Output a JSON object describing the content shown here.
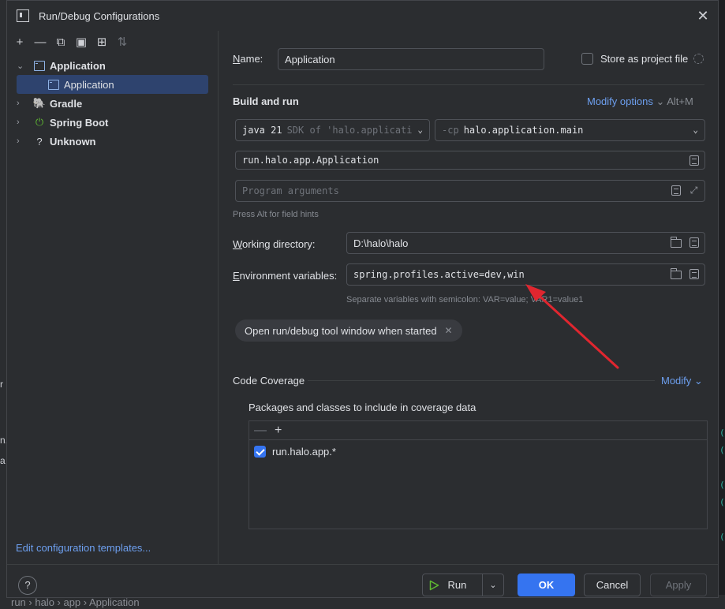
{
  "dialog": {
    "title": "Run/Debug Configurations"
  },
  "tree": {
    "groups": [
      {
        "label": "Application",
        "expanded": true,
        "children": [
          "Application"
        ]
      },
      {
        "label": "Gradle"
      },
      {
        "label": "Spring Boot"
      },
      {
        "label": "Unknown"
      }
    ],
    "edit_templates": "Edit configuration templates..."
  },
  "form": {
    "name_label": "Name:",
    "name_value": "Application",
    "store_label": "Store as project file",
    "build_run_title": "Build and run",
    "modify_options": "Modify options",
    "modify_shortcut": "Alt+M",
    "jdk_main": "java 21",
    "jdk_hint": "SDK of 'halo.applicati",
    "cp_prefix": "-cp",
    "cp_value": "halo.application.main",
    "main_class": "run.halo.app.Application",
    "program_args_placeholder": "Program arguments",
    "field_hint": "Press Alt for field hints",
    "workdir_label": "Working directory:",
    "workdir_value": "D:\\halo\\halo",
    "env_label": "Environment variables:",
    "env_value": "spring.profiles.active=dev,win",
    "env_hint": "Separate variables with semicolon: VAR=value; VAR1=value1",
    "chip_label": "Open run/debug tool window when started",
    "coverage_title": "Code Coverage",
    "coverage_modify": "Modify",
    "coverage_packages_label": "Packages and classes to include in coverage data",
    "coverage_entries": [
      "run.halo.app.*"
    ]
  },
  "footer": {
    "help": "?",
    "run": "Run",
    "ok": "OK",
    "cancel": "Cancel",
    "apply": "Apply"
  },
  "background": {
    "breadcrumb": "run  ›  halo  ›  app  ›  Application"
  },
  "colors": {
    "accent": "#3574f0",
    "link": "#6d9fef",
    "annotation_arrow": "#e0262f"
  }
}
